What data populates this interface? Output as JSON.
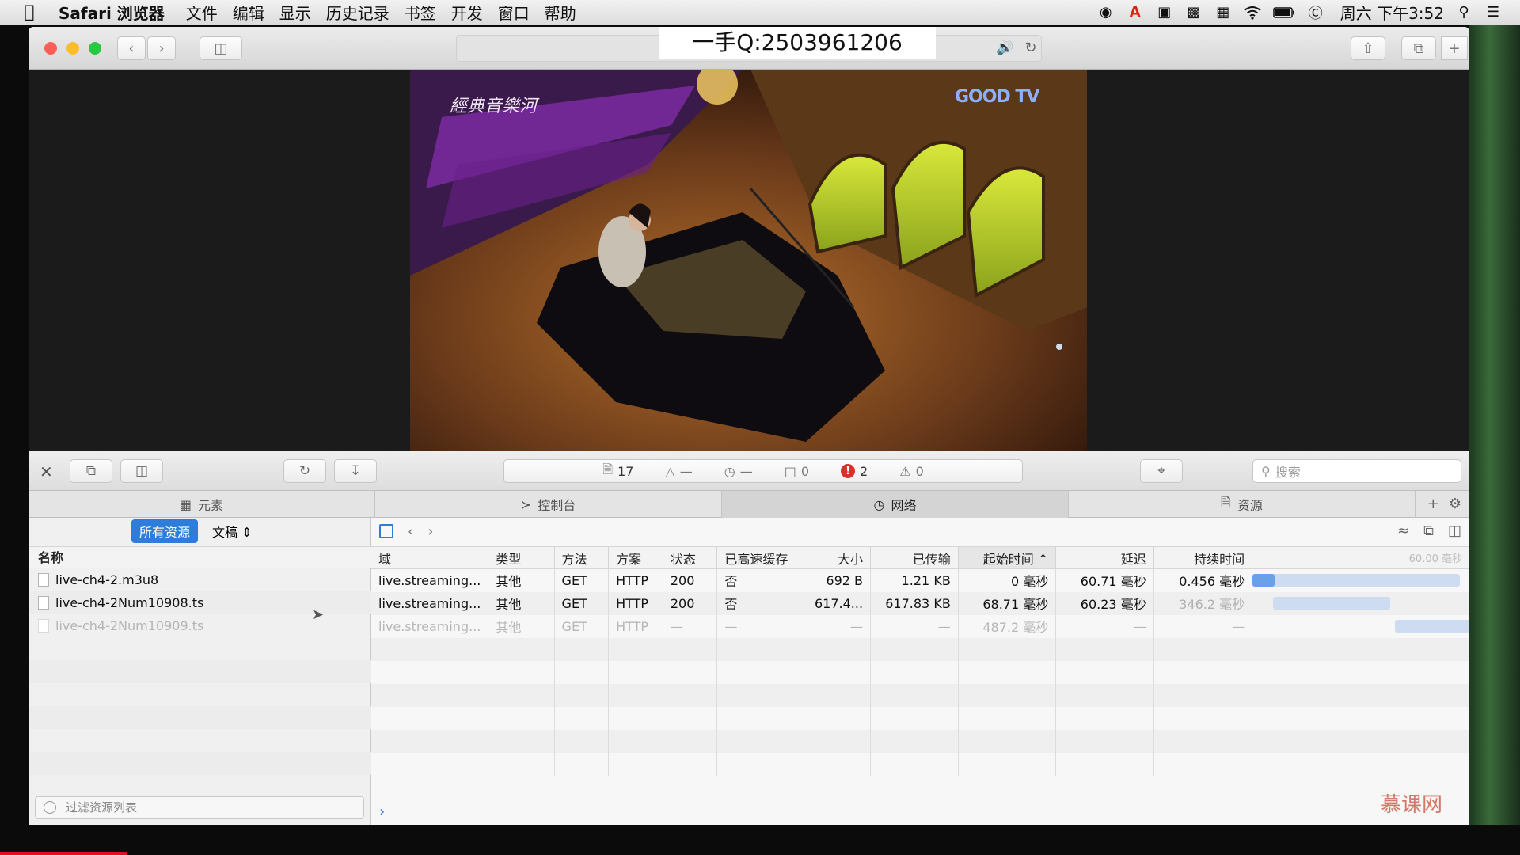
{
  "menubar": {
    "app": "Safari 浏览器",
    "items": [
      "文件",
      "编辑",
      "显示",
      "历史记录",
      "书签",
      "开发",
      "窗口",
      "帮助"
    ],
    "clock": "周六 下午3:52"
  },
  "browser": {
    "overlay_text": "一手Q:2503961206"
  },
  "video": {
    "channel_logo": "GOOD TV",
    "show_logo": "經典音樂河"
  },
  "inspector": {
    "dashboard": {
      "resources": "17",
      "size": "—",
      "time": "—",
      "logs": "0",
      "errors": "2",
      "warnings": "0"
    },
    "search_placeholder": "搜索",
    "tabs": [
      "元素",
      "控制台",
      "网络",
      "资源"
    ],
    "active_tab": "网络",
    "filter": {
      "all_label": "所有资源",
      "docs_label": "文稿"
    },
    "list_header": "名称",
    "files": [
      {
        "name": "live-ch4-2.m3u8"
      },
      {
        "name": "live-ch4-2Num10908.ts"
      },
      {
        "name": "live-ch4-2Num10909.ts"
      }
    ],
    "filter_placeholder": "过滤资源列表",
    "columns": [
      "域",
      "类型",
      "方法",
      "方案",
      "状态",
      "已高速缓存",
      "大小",
      "已传输",
      "起始时间",
      "延迟",
      "持续时间"
    ],
    "timeline_label": "60.00 毫秒",
    "rows": [
      [
        "live.streaming...",
        "其他",
        "GET",
        "HTTP",
        "200",
        "否",
        "692 B",
        "1.21 KB",
        "0 毫秒",
        "60.71 毫秒",
        "0.456 毫秒"
      ],
      [
        "live.streaming...",
        "其他",
        "GET",
        "HTTP",
        "200",
        "否",
        "617.4...",
        "617.83 KB",
        "68.71 毫秒",
        "60.23 毫秒",
        "346.2 毫秒"
      ],
      [
        "live.streaming...",
        "其他",
        "GET",
        "HTTP",
        "—",
        "—",
        "—",
        "—",
        "487.2 毫秒",
        "—",
        "—"
      ]
    ]
  },
  "brand_watermark": "慕课网",
  "colors": {
    "accent": "#2f7ddb",
    "error": "#d9302c",
    "close": "#fc5f57",
    "minimize": "#fdbc2e",
    "zoom": "#28c840"
  }
}
